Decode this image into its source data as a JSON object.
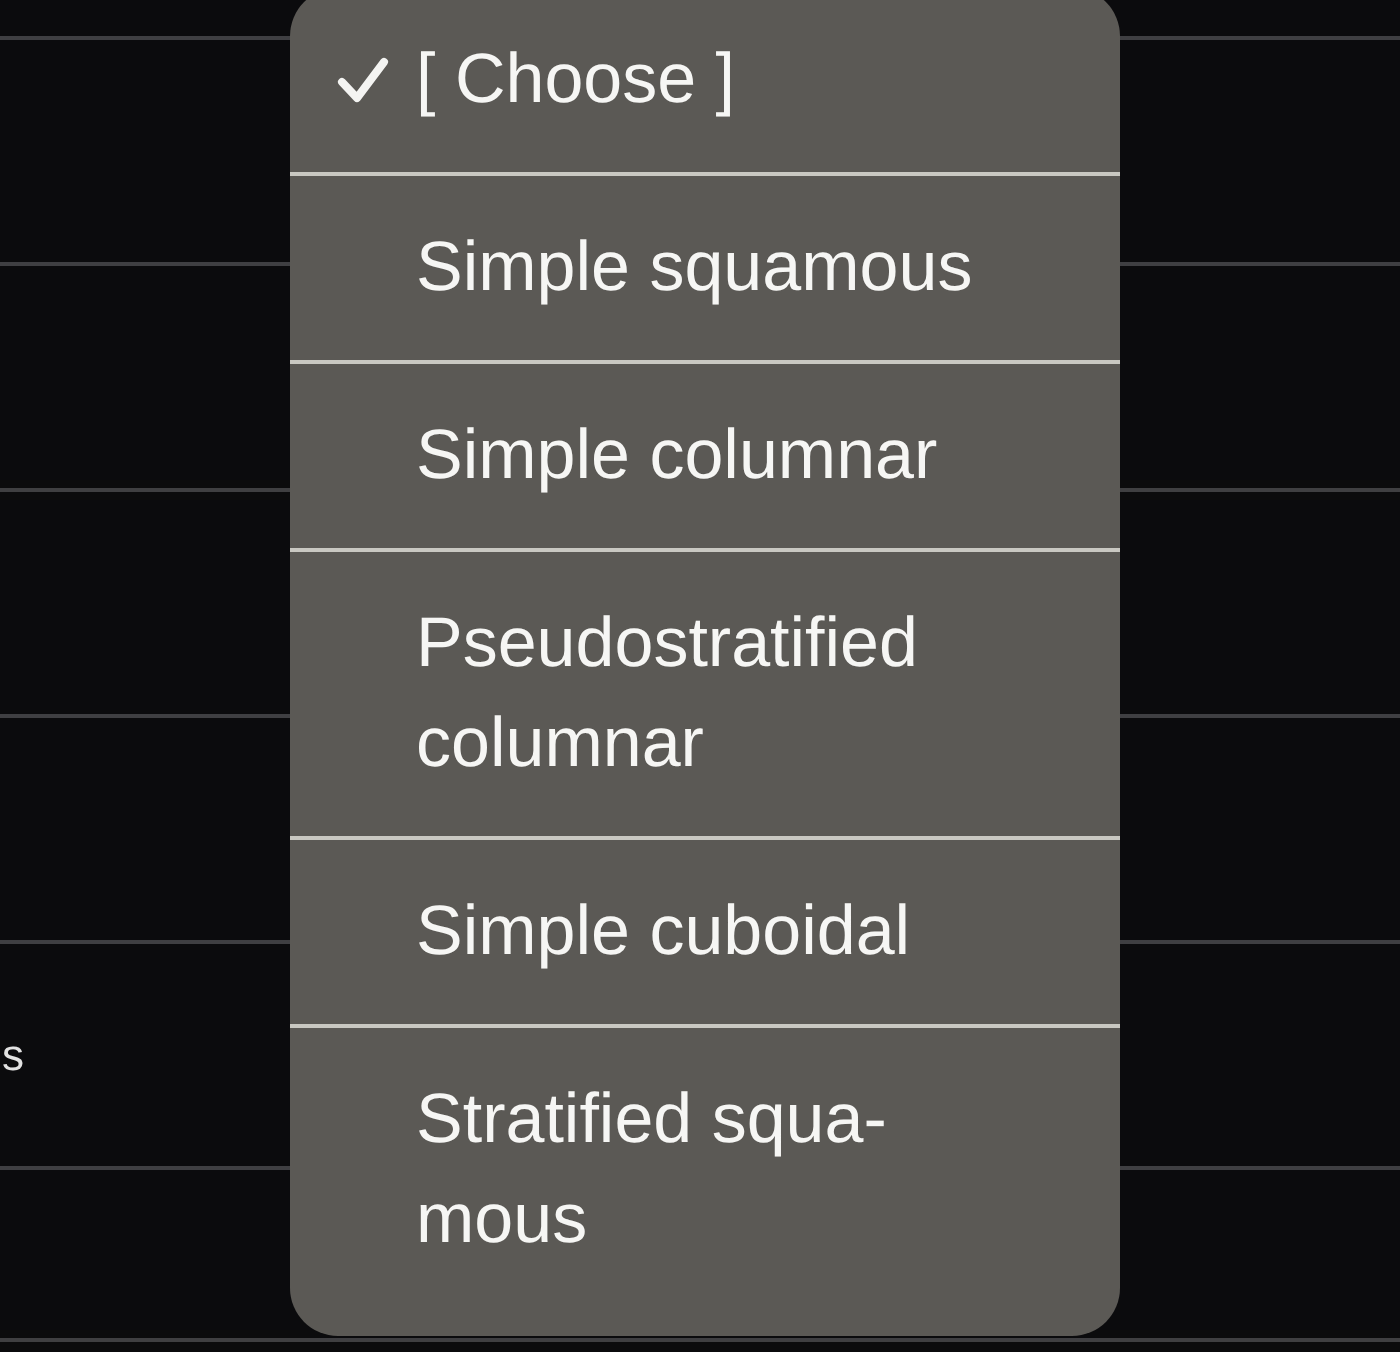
{
  "table": {
    "visible_cell_text": "s"
  },
  "dropdown_menu": {
    "options": [
      {
        "label": "[ Choose ]",
        "selected": true
      },
      {
        "label": "Simple squamous",
        "selected": false
      },
      {
        "label": "Simple columnar",
        "selected": false
      },
      {
        "label": "Pseudostratified columnar",
        "selected": false
      },
      {
        "label": "Simple cuboidal",
        "selected": false
      },
      {
        "label": "Stratified squa-mous",
        "selected": false
      }
    ]
  }
}
